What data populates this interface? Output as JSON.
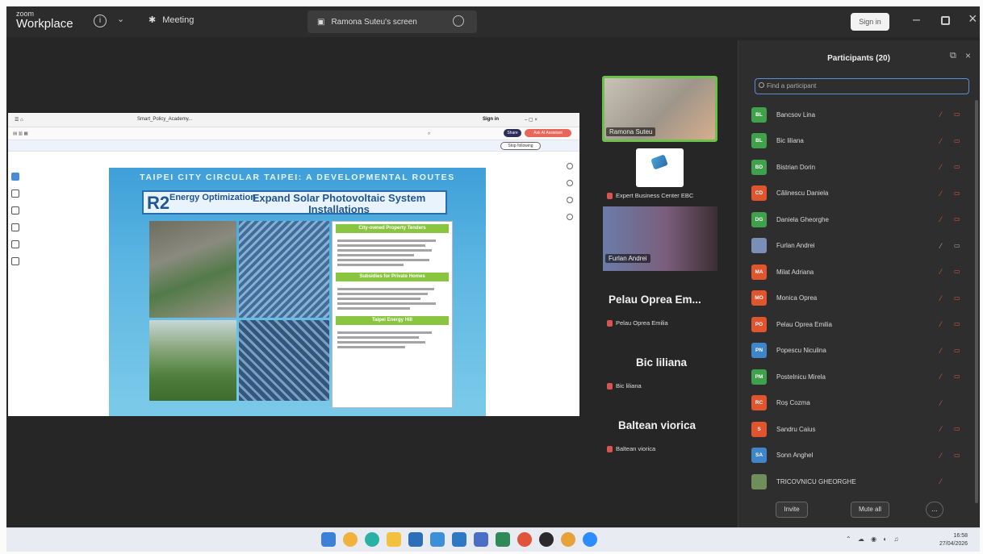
{
  "titlebar": {
    "brand_small": "zoom",
    "brand_big": "Workplace",
    "meeting_label": "Meeting",
    "screen_tab_label": "Ramona Suteu's screen",
    "sign_in_label": "Sign in"
  },
  "shared_screen": {
    "browser": {
      "sign_in": "Sign in",
      "share_label": "Share",
      "ai_label": "Ask AI Assistant",
      "tab_title": "Smart_Policy_Academy...",
      "notice_pill": "Stop following"
    },
    "slide": {
      "title": "TAIPEI CITY CIRCULAR TAIPEI: A DEVELOPMENTAL ROUTES",
      "code": "R2",
      "code_sub": "Energy Optimization",
      "headline": "Expand Solar Photovoltaic System Installations",
      "section1": "City-owned Property Tenders",
      "section2": "Subsidies for Private Homes",
      "section3": "Taipei Energy Hill"
    }
  },
  "videos": {
    "ramona_label": "Ramona Suteu",
    "expert_label": "Expert Business Center EBC",
    "furlan_label": "Furlan Andrei",
    "pelau_big": "Pelau  Oprea Em...",
    "pelau_small": "Pelau Oprea Emilia",
    "bic_big": "Bic liliana",
    "bic_small": "Bic liliana",
    "baltean_big": "Baltean viorica",
    "baltean_small": "Baltean viorica"
  },
  "participants_panel": {
    "title": "Participants (20)",
    "search_placeholder": "Find a participant",
    "invite_label": "Invite",
    "mute_all_label": "Mute all",
    "more_label": "...",
    "participants": [
      {
        "initials": "BL",
        "name": "Bancsov Lina",
        "color": "#3fa14a",
        "cam": true
      },
      {
        "initials": "BL",
        "name": "Bic liliana",
        "color": "#3fa14a",
        "cam": true
      },
      {
        "initials": "BD",
        "name": "Bistrian Dorin",
        "color": "#3fa14a",
        "cam": true
      },
      {
        "initials": "CD",
        "name": "Călinescu Daniela",
        "color": "#e0552e",
        "cam": true
      },
      {
        "initials": "DG",
        "name": "Daniela Gheorghe",
        "color": "#3fa14a",
        "cam": true
      },
      {
        "initials": "",
        "name": "Furlan Andrei",
        "color": "#7a8fb8",
        "cam": true,
        "grey": true
      },
      {
        "initials": "MA",
        "name": "Milat Adriana",
        "color": "#e0552e",
        "cam": true
      },
      {
        "initials": "MO",
        "name": "Monica Oprea",
        "color": "#e0552e",
        "cam": true
      },
      {
        "initials": "PO",
        "name": "Pelau Oprea Emilia",
        "color": "#e0552e",
        "cam": true
      },
      {
        "initials": "PN",
        "name": "Popescu Niculina",
        "color": "#3f86c9",
        "cam": true
      },
      {
        "initials": "PM",
        "name": "Postelnicu Mirela",
        "color": "#3fa14a",
        "cam": true
      },
      {
        "initials": "RC",
        "name": "Roș Cozma",
        "color": "#e0552e",
        "cam": false
      },
      {
        "initials": "S",
        "name": "Sandru Caius",
        "color": "#e0552e",
        "cam": true
      },
      {
        "initials": "SA",
        "name": "Sonn Anghel",
        "color": "#3f86c9",
        "cam": true
      },
      {
        "initials": "",
        "name": "TRICOVNICU GHEORGHE",
        "color": "#6f8f5a",
        "cam": false
      }
    ]
  },
  "taskbar": {
    "time": "16:58",
    "date": "27/04/2026"
  },
  "colors": {
    "accent_blue": "#5a8ed6",
    "mute_red": "#e05545",
    "active_green": "#6ac24a"
  }
}
